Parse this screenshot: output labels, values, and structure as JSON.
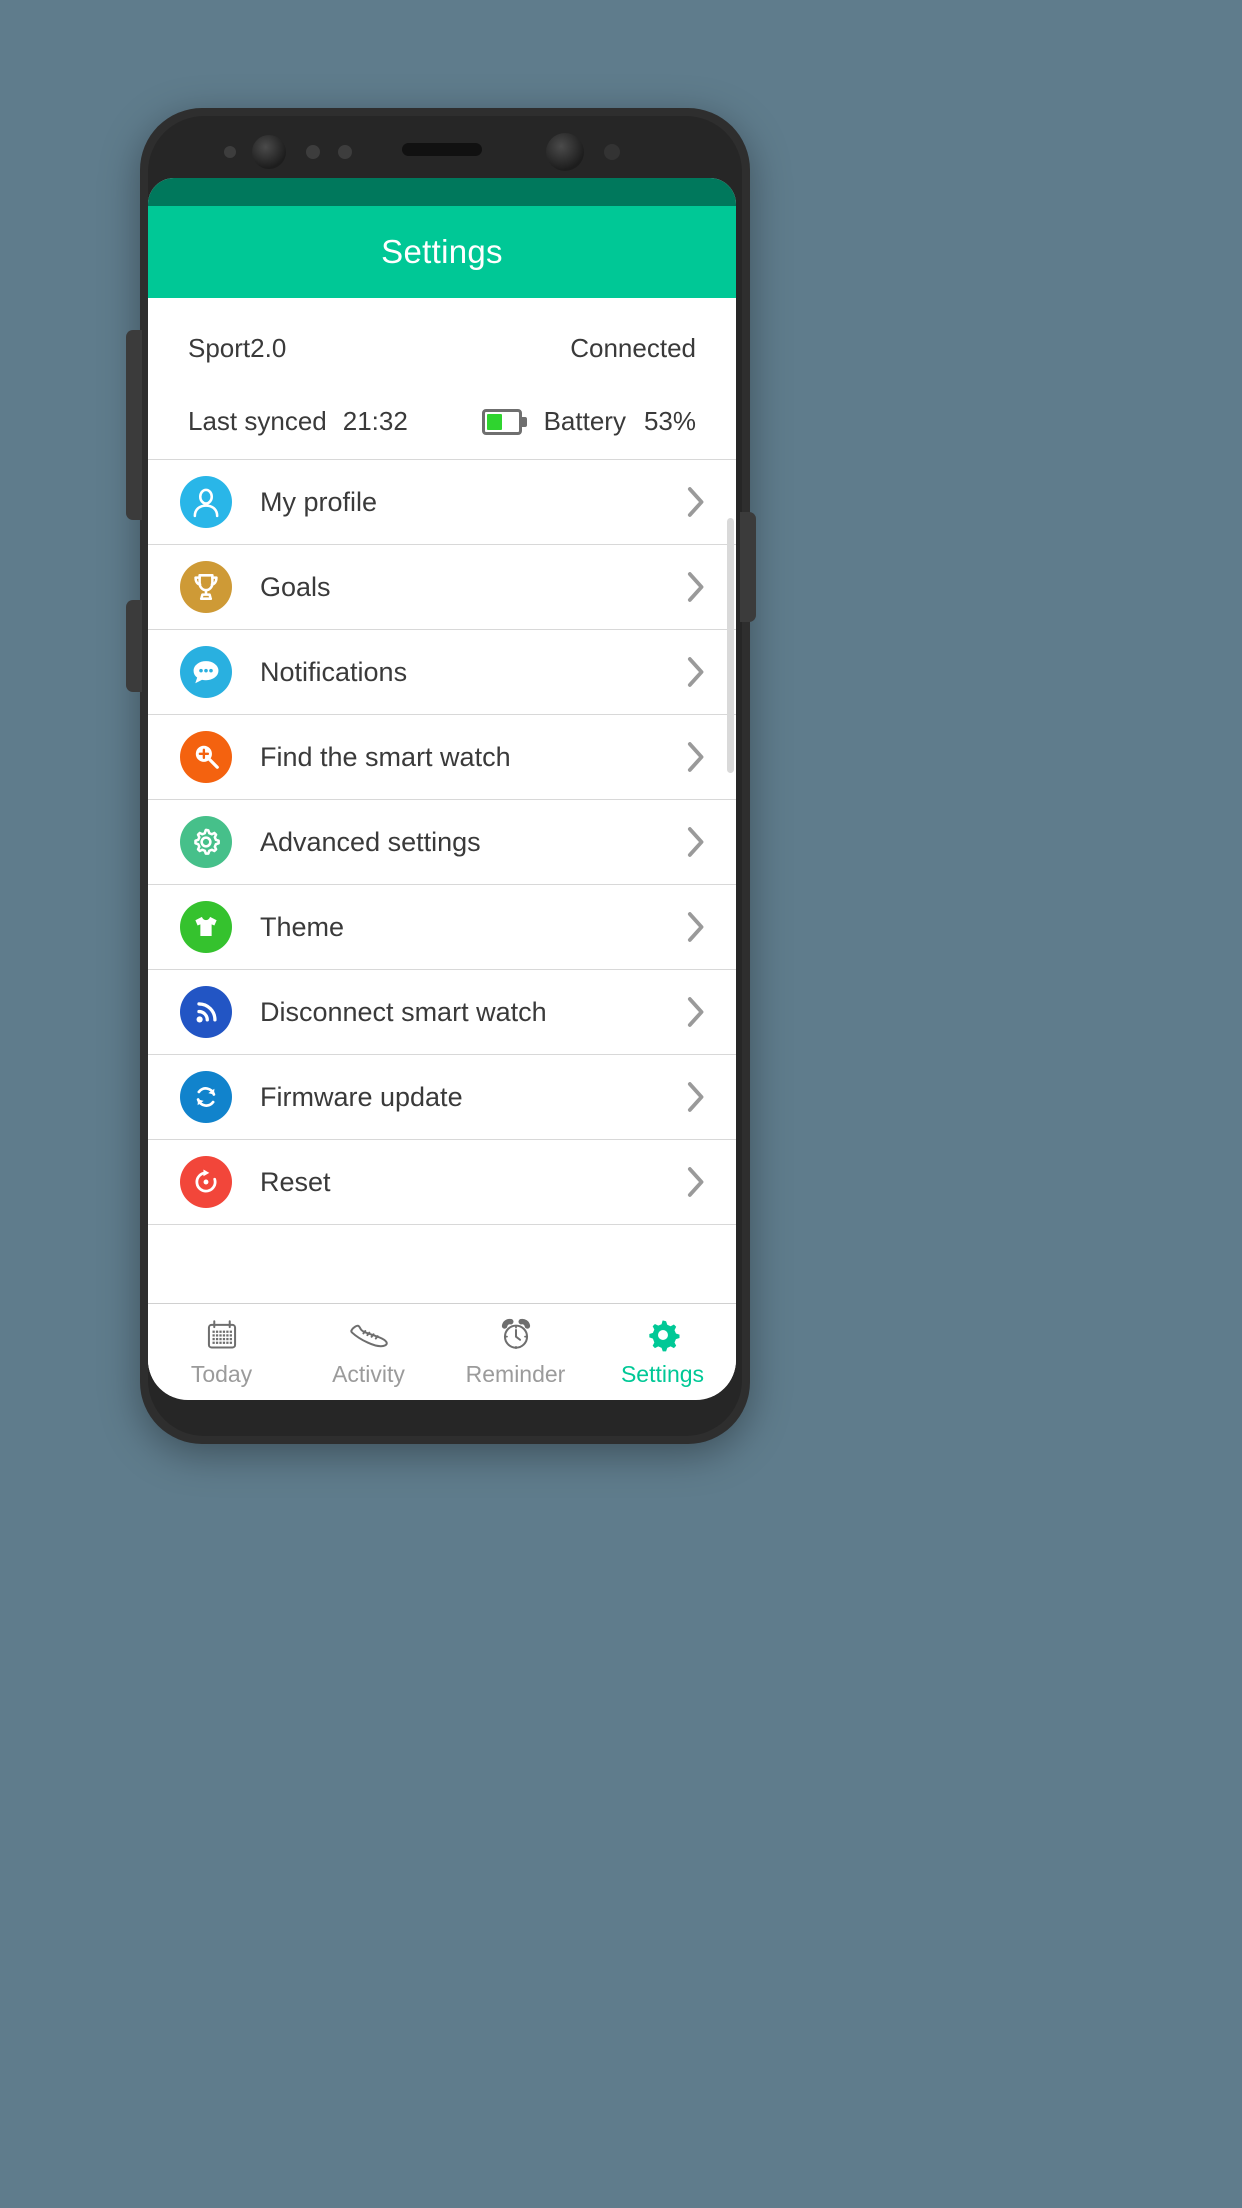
{
  "app": {
    "title": "Settings"
  },
  "device": {
    "name": "Sport2.0",
    "connection_status": "Connected",
    "last_synced_label": "Last synced",
    "last_synced_time": "21:32",
    "battery_label": "Battery",
    "battery_percent": "53%",
    "battery_level": 53
  },
  "settings_items": [
    {
      "label": "My profile",
      "icon": "person-icon",
      "color": "#29b6e8"
    },
    {
      "label": "Goals",
      "icon": "trophy-icon",
      "color": "#ce9a36"
    },
    {
      "label": "Notifications",
      "icon": "chat-bubble-icon",
      "color": "#29b0e0"
    },
    {
      "label": "Find the smart watch",
      "icon": "search-plus-icon",
      "color": "#f4620f"
    },
    {
      "label": "Advanced settings",
      "icon": "gear-icon",
      "color": "#46c08a"
    },
    {
      "label": "Theme",
      "icon": "tshirt-icon",
      "color": "#35c22e"
    },
    {
      "label": "Disconnect smart watch",
      "icon": "signal-waves-icon",
      "color": "#2255c4"
    },
    {
      "label": "Firmware update",
      "icon": "sync-arrows-icon",
      "color": "#1183cc"
    },
    {
      "label": "Reset",
      "icon": "reset-circle-icon",
      "color": "#f2463a"
    }
  ],
  "tabs": [
    {
      "label": "Today",
      "icon": "calendar-icon",
      "active": false
    },
    {
      "label": "Activity",
      "icon": "shoe-icon",
      "active": false
    },
    {
      "label": "Reminder",
      "icon": "alarm-clock-icon",
      "active": false
    },
    {
      "label": "Settings",
      "icon": "gear-icon",
      "active": true
    }
  ],
  "colors": {
    "accent": "#00c896",
    "appbar_dark": "#00785c",
    "backdrop": "#5f7c8c",
    "phone_body": "#2e2e2e",
    "text": "#3a3a3a",
    "tab_inactive": "#9b9b9b"
  }
}
